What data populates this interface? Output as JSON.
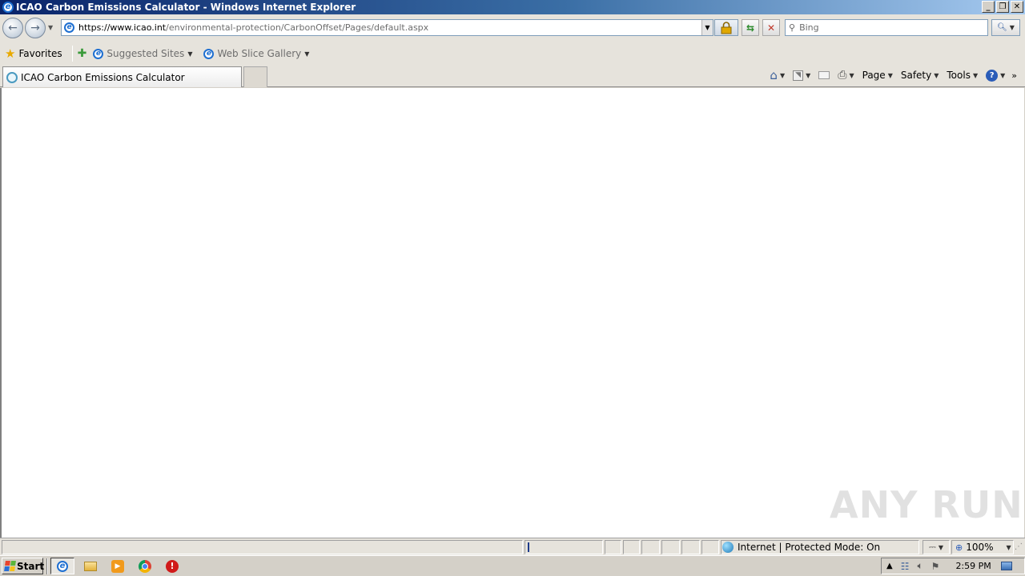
{
  "window": {
    "title": "ICAO Carbon Emissions Calculator - Windows Internet Explorer",
    "controls": {
      "minimize": "_",
      "restore": "❐",
      "close": "✕"
    }
  },
  "address_bar": {
    "url_main": "https://www.icao.int",
    "url_rest": "/environmental-protection/CarbonOffset/Pages/default.aspx"
  },
  "search": {
    "placeholder": "Bing"
  },
  "favorites_bar": {
    "favorites_label": "Favorites",
    "links": [
      {
        "label": "Suggested Sites"
      },
      {
        "label": "Web Slice Gallery"
      }
    ]
  },
  "tabs": [
    {
      "label": "ICAO Carbon Emissions Calculator"
    }
  ],
  "command_bar": {
    "page": "Page",
    "safety": "Safety",
    "tools": "Tools"
  },
  "status_bar": {
    "zone": "Internet | Protected Mode: On",
    "zoom": "100%"
  },
  "taskbar": {
    "start_label": "Start",
    "clock": "2:59 PM"
  },
  "watermark": "ANY RUN",
  "colors": {
    "title_gradient_start": "#0a246a",
    "title_gradient_end": "#a6caf0",
    "chrome": "#e6e3dc",
    "taskbar": "#d4d0c8"
  }
}
